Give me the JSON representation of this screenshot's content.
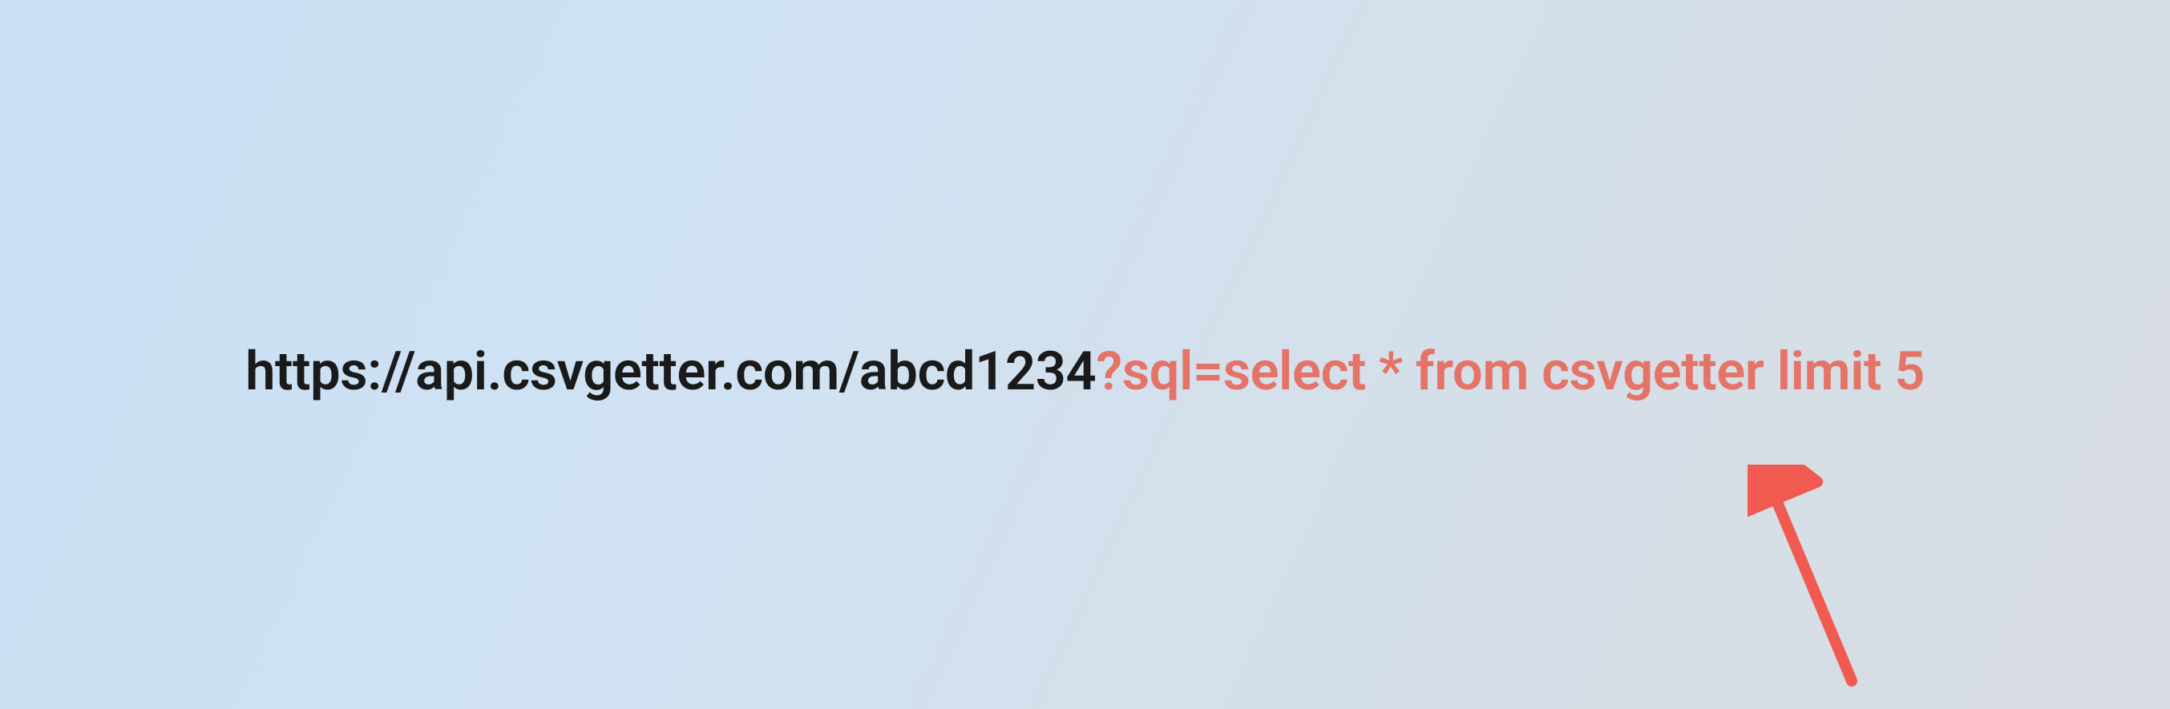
{
  "url": {
    "base": "https://api.csvgetter.com/abcd1234",
    "query": "?sql=select * from csvgetter limit 5"
  },
  "colors": {
    "text_primary": "#1a1a1a",
    "text_highlight": "#e57368",
    "arrow": "#f05a50"
  }
}
